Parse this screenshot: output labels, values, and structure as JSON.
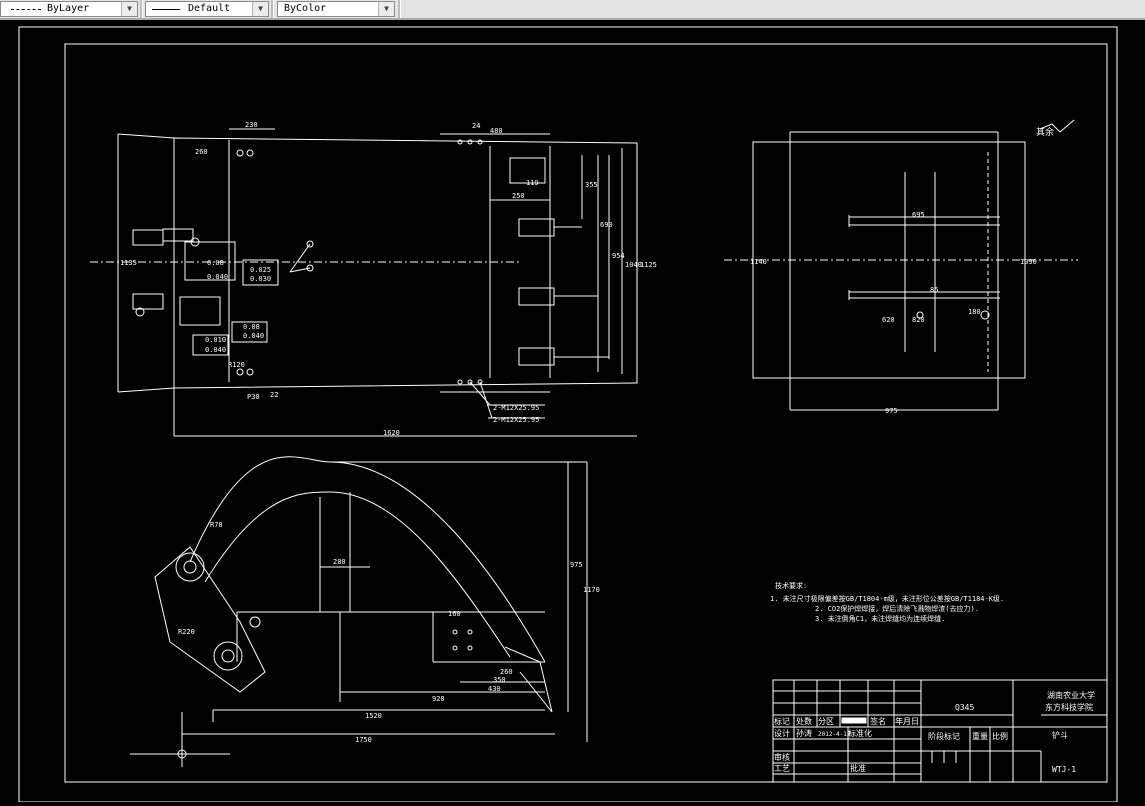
{
  "toolbar": {
    "linetype_value": "ByLayer",
    "linestyle_value": "Default",
    "color_value": "ByColor"
  },
  "drawing": {
    "roughness_symbol": "其余",
    "dims_main": [
      "1620",
      "260",
      "230",
      "119",
      "250",
      "480",
      "355",
      "690",
      "954",
      "1040",
      "1125",
      "1135",
      "Φ30",
      "P30",
      "24",
      "22",
      "R120"
    ],
    "hole_notes": [
      "2-M12X25.95",
      "2-M12X25.95"
    ],
    "tolerances": [
      "0.08",
      "0.025",
      "0.040",
      "0.030",
      "0.08",
      "0.040",
      "0.010",
      "0.040",
      "0.08",
      "0.040"
    ],
    "side_dims": [
      "975",
      "1140",
      "1090",
      "695",
      "620",
      "820",
      "85",
      "180"
    ],
    "bottom_dims": [
      "1750",
      "1520",
      "920",
      "430",
      "350",
      "260",
      "160",
      "975",
      "1170",
      "280",
      "R70",
      "R220"
    ],
    "tech_title": "技术要求:",
    "tech_notes": [
      "1. 未注尺寸极限偏差按GB/T1804-m级，未注形位公差按GB/T1184-K级.",
      "2. CO2保护焊焊接，焊后清除飞溅物焊渣(去应力).",
      "3. 未注倒角C1，未注焊缝均为连续焊缝."
    ]
  },
  "title_block": {
    "material": "Q345",
    "school_line1": "湖南农业大学",
    "school_line2": "东方科技学院",
    "part_name": "铲斗",
    "drawing_no": "WTJ-1",
    "row_labels": [
      "标记",
      "处数",
      "分区",
      "签名",
      "年月日"
    ],
    "design_label": "设计",
    "designer": "孙涛",
    "date": "2012-4-15",
    "std_label": "标准化",
    "stage_label": "阶段标记",
    "weight_label": "重量",
    "scale_label": "比例",
    "check_label": "审核",
    "process_label": "工艺",
    "approve_label": "批准"
  },
  "colors": {
    "background": "#000000",
    "lines": "#ffffff",
    "toolbar": "#e4e4e4"
  }
}
